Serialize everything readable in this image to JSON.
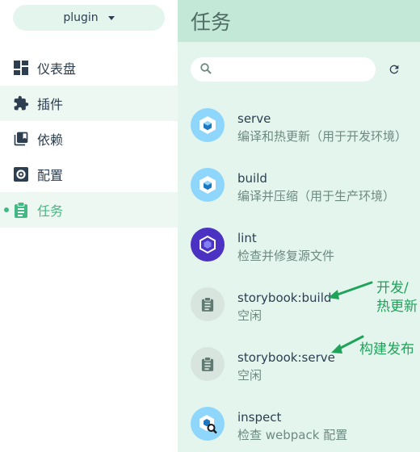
{
  "sidebar": {
    "project": "plugin",
    "items": [
      {
        "label": "仪表盘",
        "icon": "dashboard-icon"
      },
      {
        "label": "插件",
        "icon": "puzzle-icon"
      },
      {
        "label": "依赖",
        "icon": "library-icon"
      },
      {
        "label": "配置",
        "icon": "settings-icon"
      },
      {
        "label": "任务",
        "icon": "clipboard-icon"
      }
    ]
  },
  "main": {
    "title": "任务",
    "search": {
      "placeholder": "",
      "value": ""
    },
    "tasks": [
      {
        "name": "serve",
        "description": "编译和热更新（用于开发环境）",
        "icon": "webpack-icon"
      },
      {
        "name": "build",
        "description": "编译并压缩（用于生产环境）",
        "icon": "webpack-icon"
      },
      {
        "name": "lint",
        "description": "检查并修复源文件",
        "icon": "eslint-icon"
      },
      {
        "name": "storybook:build",
        "description": "空闲",
        "icon": "clipboard-icon"
      },
      {
        "name": "storybook:serve",
        "description": "空闲",
        "icon": "clipboard-icon"
      },
      {
        "name": "inspect",
        "description": "检查 webpack 配置",
        "icon": "webpack-inspect-icon"
      }
    ]
  },
  "annotations": {
    "build_note_line1": "开发/",
    "build_note_line2": "热更新",
    "serve_note": "构建发布"
  },
  "colors": {
    "accent": "#42b983",
    "annotation": "#1fa35a",
    "main_bg": "#e4f5ee",
    "header_bg": "#c3e8d8"
  }
}
